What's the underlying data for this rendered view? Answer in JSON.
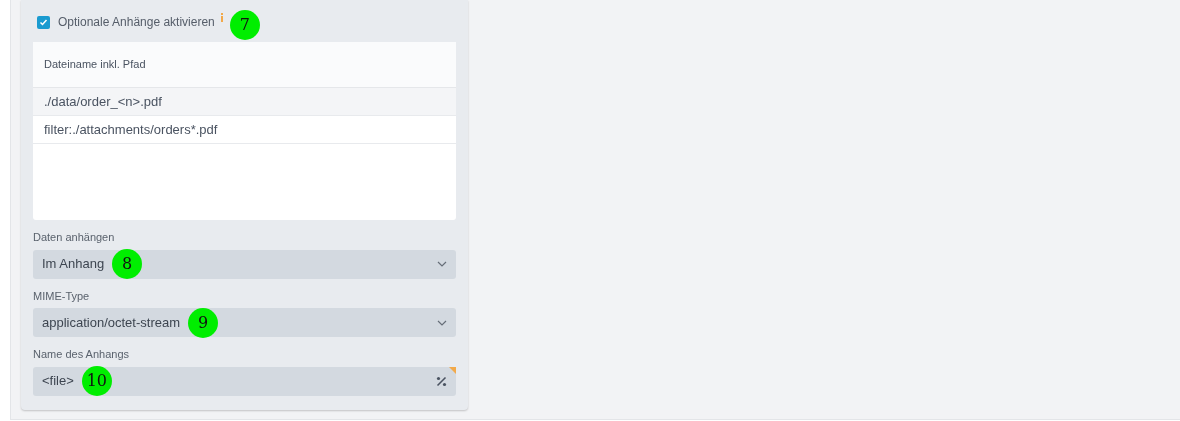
{
  "attachments": {
    "enabled": {
      "label": "Optionale Anhänge aktivieren",
      "checked": true,
      "callout": "7"
    },
    "table": {
      "columns": [
        "Dateiname inkl. Pfad"
      ],
      "rows": [
        {
          "cells": [
            "./data/order_<n>.pdf"
          ]
        },
        {
          "cells": [
            "filter:./attachments/orders*.pdf"
          ]
        }
      ]
    },
    "fields": [
      {
        "kind": "select",
        "label": "Daten anhängen",
        "value": "Im Anhang",
        "callout": "8"
      },
      {
        "kind": "select",
        "label": "MIME-Type",
        "value": "application/octet-stream",
        "callout": "9"
      },
      {
        "kind": "text",
        "label": "Name des Anhangs",
        "value": "<file>",
        "flagged": true,
        "callout": "10"
      }
    ]
  }
}
